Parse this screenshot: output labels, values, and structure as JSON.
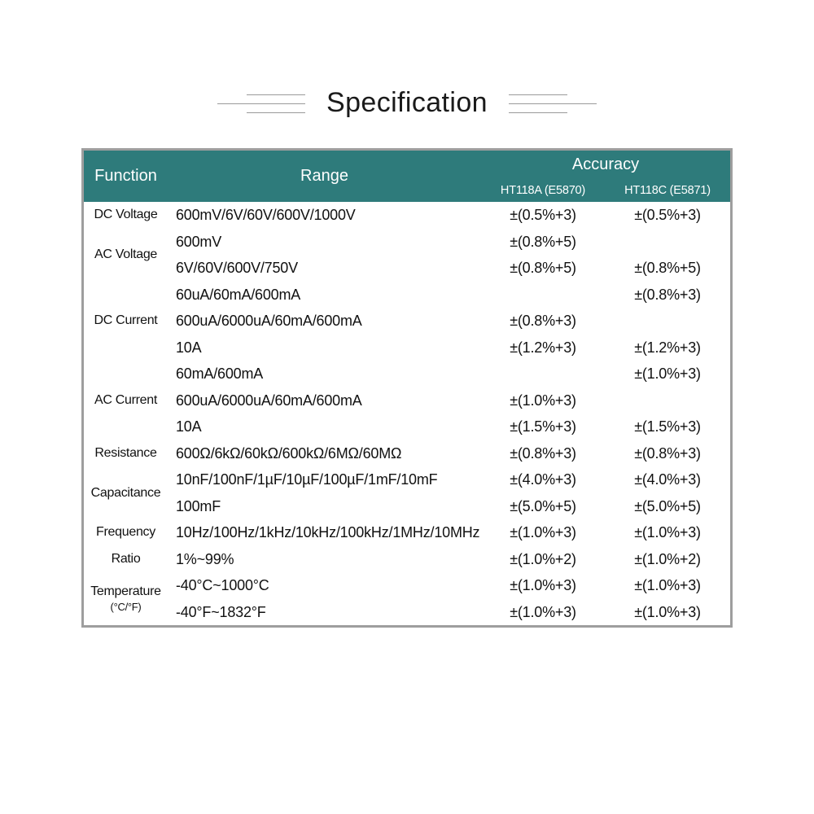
{
  "title": "Specification",
  "colors": {
    "header_teal": "#2e7b7b",
    "grid_gray": "#9e9e9e",
    "text": "#111111",
    "deco_line": "#9a9a9a"
  },
  "table": {
    "headers": {
      "function": "Function",
      "range": "Range",
      "accuracy": "Accuracy",
      "model_a": "HT118A (E5870)",
      "model_c": "HT118C (E5871)"
    },
    "rows": [
      {
        "function": "DC Voltage",
        "function_sub": "",
        "span": 1,
        "items": [
          {
            "range": "600mV/6V/60V/600V/1000V",
            "a": "±(0.5%+3)",
            "c": "±(0.5%+3)"
          }
        ]
      },
      {
        "function": "AC Voltage",
        "function_sub": "",
        "span": 2,
        "items": [
          {
            "range": "600mV",
            "a": "±(0.8%+5)",
            "c": ""
          },
          {
            "range": "6V/60V/600V/750V",
            "a": "±(0.8%+5)",
            "c": "±(0.8%+5)"
          }
        ]
      },
      {
        "function": "DC Current",
        "function_sub": "",
        "span": 3,
        "items": [
          {
            "range": "60uA/60mA/600mA",
            "a": "",
            "c": "±(0.8%+3)"
          },
          {
            "range": "600uA/6000uA/60mA/600mA",
            "a": "±(0.8%+3)",
            "c": ""
          },
          {
            "range": "10A",
            "a": "±(1.2%+3)",
            "c": "±(1.2%+3)"
          }
        ]
      },
      {
        "function": "AC Current",
        "function_sub": "",
        "span": 3,
        "items": [
          {
            "range": "60mA/600mA",
            "a": "",
            "c": "±(1.0%+3)"
          },
          {
            "range": "600uA/6000uA/60mA/600mA",
            "a": "±(1.0%+3)",
            "c": ""
          },
          {
            "range": "10A",
            "a": "±(1.5%+3)",
            "c": "±(1.5%+3)"
          }
        ]
      },
      {
        "function": "Resistance",
        "function_sub": "",
        "span": 1,
        "items": [
          {
            "range": "600Ω/6kΩ/60kΩ/600kΩ/6MΩ/60MΩ",
            "a": "±(0.8%+3)",
            "c": "±(0.8%+3)"
          }
        ]
      },
      {
        "function": "Capacitance",
        "function_sub": "",
        "span": 2,
        "items": [
          {
            "range": "10nF/100nF/1µF/10µF/100µF/1mF/10mF",
            "a": "±(4.0%+3)",
            "c": "±(4.0%+3)"
          },
          {
            "range": "100mF",
            "a": "±(5.0%+5)",
            "c": "±(5.0%+5)"
          }
        ]
      },
      {
        "function": "Frequency",
        "function_sub": "",
        "span": 1,
        "items": [
          {
            "range": "10Hz/100Hz/1kHz/10kHz/100kHz/1MHz/10MHz",
            "a": "±(1.0%+3)",
            "c": "±(1.0%+3)"
          }
        ]
      },
      {
        "function": "Ratio",
        "function_sub": "",
        "span": 1,
        "items": [
          {
            "range": "1%~99%",
            "a": "±(1.0%+2)",
            "c": "±(1.0%+2)"
          }
        ]
      },
      {
        "function": "Temperature",
        "function_sub": "(°C/°F)",
        "span": 2,
        "items": [
          {
            "range": "-40°C~1000°C",
            "a": "±(1.0%+3)",
            "c": "±(1.0%+3)"
          },
          {
            "range": "-40°F~1832°F",
            "a": "±(1.0%+3)",
            "c": "±(1.0%+3)"
          }
        ]
      }
    ]
  }
}
